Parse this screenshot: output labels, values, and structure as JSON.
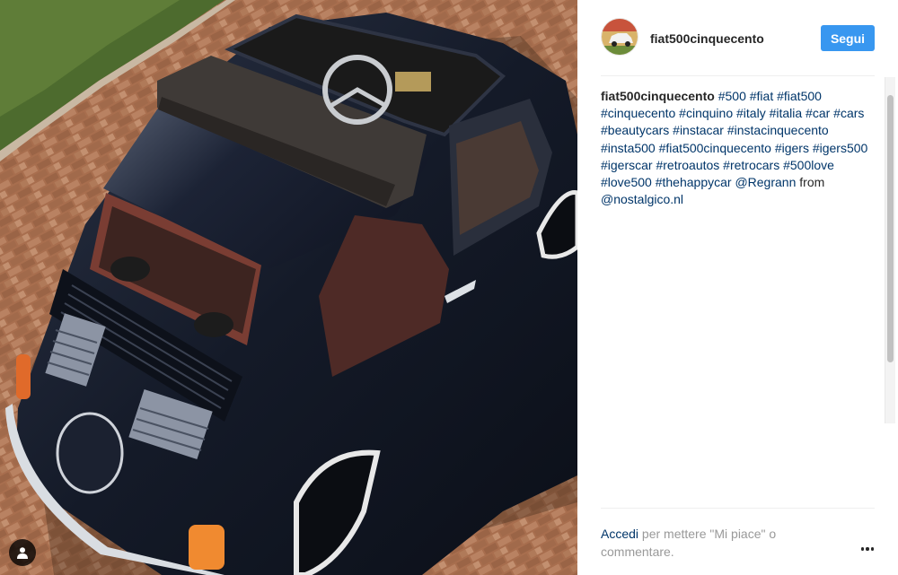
{
  "post": {
    "username": "fiat500cinquecento",
    "follow_label": "Segui",
    "caption": {
      "author": "fiat500cinquecento",
      "hashtags": "#500 #fiat #fiat500 #cinquecento #cinquino #italy #italia #car #cars #beautycars #instacar #instacinquecento #insta500 #fiat500cinquecento #igers #igers500 #igerscar #retroautos #retrocars #500love #love500 #thehappycar",
      "mention": "@Regrann",
      "from_text": "from",
      "source": "@nostalgico.nl"
    },
    "footer": {
      "login_link": "Accedi",
      "rest": "per mettere \"Mi piace\" o commentare."
    }
  },
  "icons": {
    "tag": "user-tag-icon",
    "more": "more-options-icon"
  },
  "colors": {
    "accent": "#3897f0",
    "link": "#003569",
    "muted": "#999999",
    "car_body": "#141a28",
    "interior": "#8e4038",
    "cobblestone": "#a56c4c"
  }
}
